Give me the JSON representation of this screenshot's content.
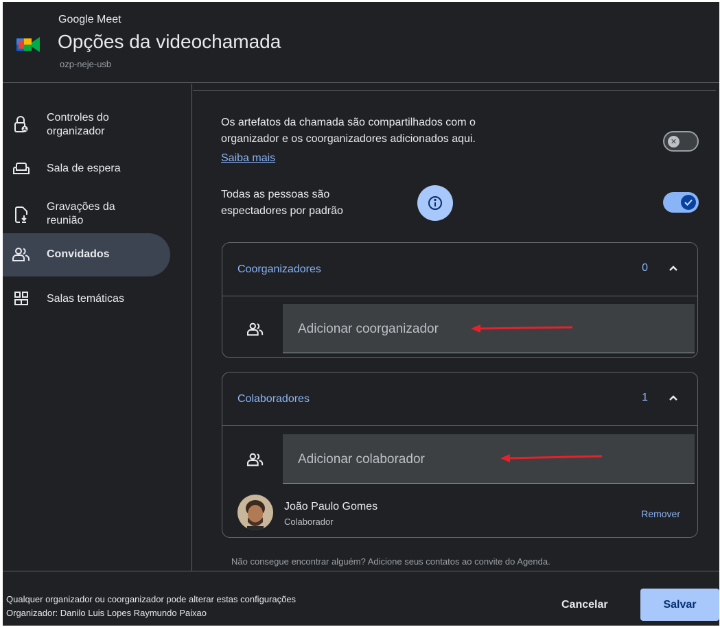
{
  "header": {
    "app_name": "Google Meet",
    "title": "Opções da videochamada",
    "meeting_code": "ozp-neje-usb",
    "logo_icon": "google-meet-logo"
  },
  "sidebar": {
    "items": [
      {
        "label": "Controles do\norganizador",
        "icon": "lock-person-icon",
        "active": false
      },
      {
        "label": "Sala de espera",
        "icon": "couch-icon",
        "active": false
      },
      {
        "label": "Gravações da\nreunião",
        "icon": "file-download-icon",
        "active": false
      },
      {
        "label": "Convidados",
        "icon": "people-icon",
        "active": true
      },
      {
        "label": "Salas temáticas",
        "icon": "breakout-rooms-icon",
        "active": false
      }
    ]
  },
  "main": {
    "artifacts_text": "Os artefatos da chamada são compartilhados com o\norganizador e os coorganizadores adicionados aqui.",
    "learn_more": "Saiba mais",
    "artifacts_toggle": false,
    "viewers_text": "Todas as pessoas são\nespectadores por padrão",
    "viewers_toggle": true,
    "coorganizers": {
      "title": "Coorganizadores",
      "count": "0",
      "placeholder": "Adicionar coorganizador"
    },
    "collaborators": {
      "title": "Colaboradores",
      "count": "1",
      "placeholder": "Adicionar colaborador",
      "people": [
        {
          "name": "João Paulo Gomes",
          "role": "Colaborador",
          "action": "Remover"
        }
      ]
    },
    "hint": "Não consegue encontrar alguém? Adicione seus contatos ao convite do Agenda."
  },
  "footer": {
    "line1": "Qualquer organizador ou coorganizador pode alterar estas configurações",
    "line2": "Organizador: Danilo Luis Lopes Raymundo Paixao",
    "cancel": "Cancelar",
    "save": "Salvar"
  },
  "colors": {
    "background": "#202124",
    "accent": "#8ab4f8",
    "save_button": "#a8c7fa",
    "active_nav": "#3c4452",
    "annotation_arrow": "#e8202a"
  }
}
